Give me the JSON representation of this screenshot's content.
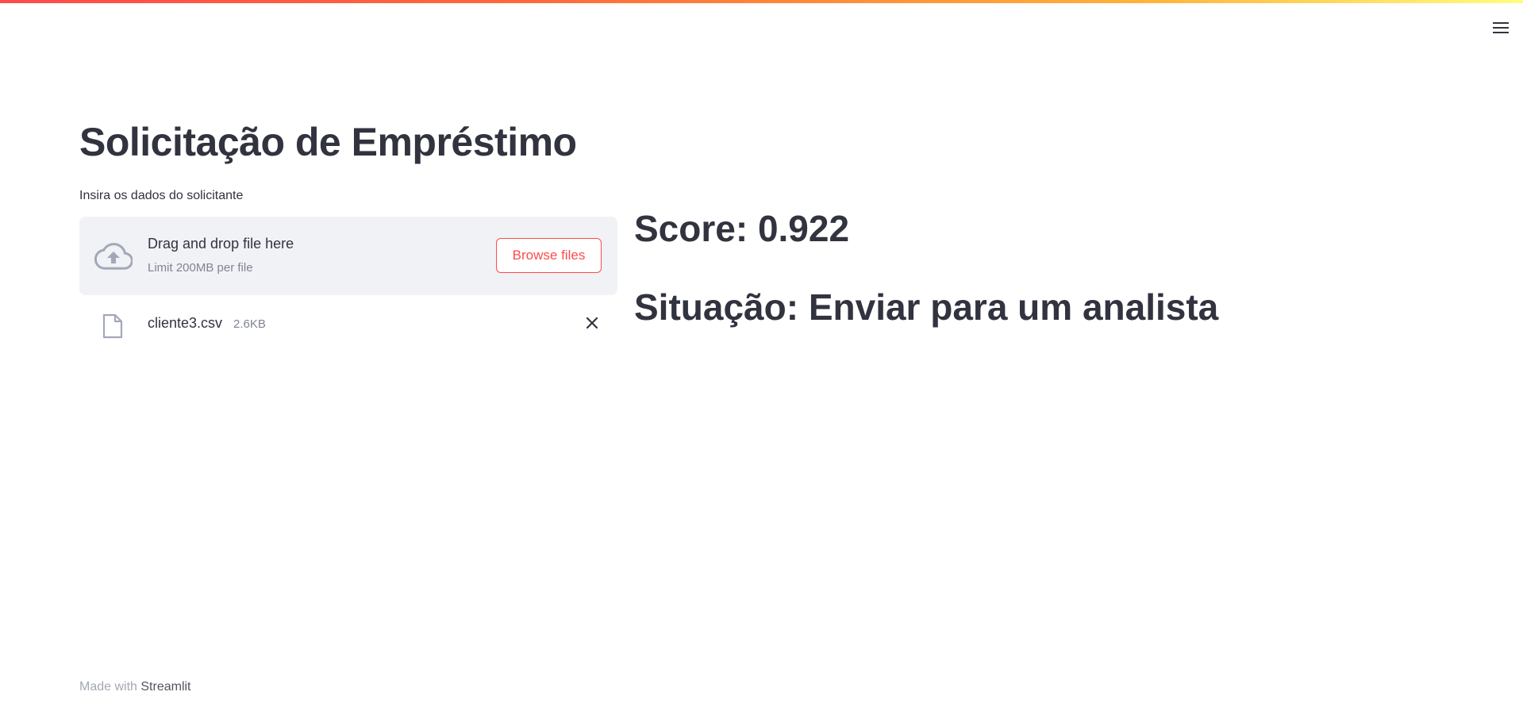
{
  "header": {
    "menu_icon": "hamburger-menu-icon",
    "decoration_colors": [
      "#ff4b4b",
      "#ff6a3a",
      "#ffb13b",
      "#fffd80"
    ]
  },
  "main": {
    "title": "Solicitação de Empréstimo",
    "uploader": {
      "label": "Insira os dados do solicitante",
      "icon": "cloud-upload-icon",
      "instructions": "Drag and drop file here",
      "limit": "Limit 200MB per file",
      "browse_label": "Browse files",
      "file": {
        "icon": "file-icon",
        "name": "cliente3.csv",
        "size": "2.6KB",
        "remove_icon": "close-icon"
      }
    },
    "score_text": "Score: 0.922",
    "status_text": "Situação: Enviar para um analista"
  },
  "footer": {
    "prefix": "Made with",
    "link_label": "Streamlit"
  },
  "colors": {
    "primary": "#ff4b4b",
    "text": "#31333f",
    "muted": "#808495",
    "dropzone_bg": "#f0f2f6"
  }
}
